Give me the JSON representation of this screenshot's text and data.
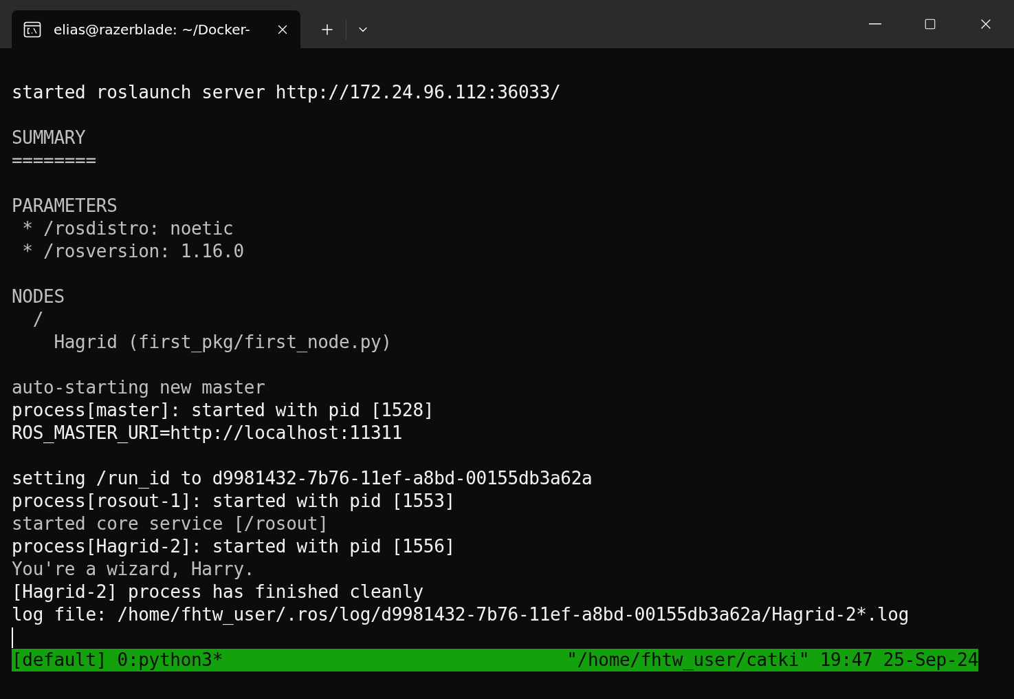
{
  "tab": {
    "title": "elias@razerblade: ~/Docker-",
    "selected": true
  },
  "terminal": {
    "blocks": [
      [
        {
          "text": "started roslaunch server http://172.24.96.112:36033/",
          "bright": true
        }
      ],
      [
        {
          "text": "SUMMARY",
          "bright": false
        },
        {
          "text": "========",
          "bright": false
        }
      ],
      [
        {
          "text": "PARAMETERS",
          "bright": false
        },
        {
          "text": " * /rosdistro: noetic",
          "bright": false
        },
        {
          "text": " * /rosversion: 1.16.0",
          "bright": false
        }
      ],
      [
        {
          "text": "NODES",
          "bright": false
        },
        {
          "text": "  /",
          "bright": false
        },
        {
          "text": "    Hagrid (first_pkg/first_node.py)",
          "bright": false
        }
      ],
      [
        {
          "text": "auto-starting new master",
          "bright": false
        },
        {
          "text": "process[master]: started with pid [1528]",
          "bright": true
        },
        {
          "text": "ROS_MASTER_URI=http://localhost:11311",
          "bright": true
        }
      ],
      [
        {
          "text": "setting /run_id to d9981432-7b76-11ef-a8bd-00155db3a62a",
          "bright": true
        },
        {
          "text": "process[rosout-1]: started with pid [1553]",
          "bright": true
        },
        {
          "text": "started core service [/rosout]",
          "bright": false
        },
        {
          "text": "process[Hagrid-2]: started with pid [1556]",
          "bright": true
        },
        {
          "text": "You're a wizard, Harry.",
          "bright": false
        },
        {
          "text": "[Hagrid-2] process has finished cleanly",
          "bright": true
        },
        {
          "text": "log file: /home/fhtw_user/.ros/log/d9981432-7b76-11ef-a8bd-00155db3a62a/Hagrid-2*.log",
          "bright": true
        }
      ]
    ]
  },
  "status_bar": {
    "left": "[default] 0:python3*",
    "right": "\"/home/fhtw_user/catki\" 19:47 25-Sep-24"
  }
}
